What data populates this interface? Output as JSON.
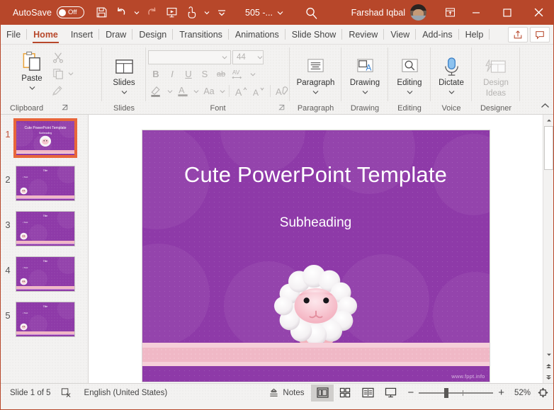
{
  "titlebar": {
    "autosave_label": "AutoSave",
    "autosave_state": "Off",
    "doc_name": "505 -...",
    "user_name": "Farshad Iqbal",
    "qat": [
      {
        "name": "save-icon",
        "label": "Save"
      },
      {
        "name": "undo-icon",
        "label": "Undo"
      },
      {
        "name": "redo-icon",
        "label": "Redo"
      },
      {
        "name": "start-presentation-icon",
        "label": "Start From Beginning"
      },
      {
        "name": "touch-mode-icon",
        "label": "Touch/Mouse Mode"
      },
      {
        "name": "customize-qat-icon",
        "label": "Customize Quick Access Toolbar"
      }
    ],
    "search_icon": "search-icon",
    "ribbon_display_icon": "ribbon-display-options-icon",
    "minimize": "–",
    "maximize": "□",
    "close": "✕"
  },
  "tabs": [
    {
      "label": "File",
      "active": false
    },
    {
      "label": "Home",
      "active": true
    },
    {
      "label": "Insert",
      "active": false
    },
    {
      "label": "Draw",
      "active": false
    },
    {
      "label": "Design",
      "active": false
    },
    {
      "label": "Transitions",
      "active": false
    },
    {
      "label": "Animations",
      "active": false
    },
    {
      "label": "Slide Show",
      "active": false
    },
    {
      "label": "Review",
      "active": false
    },
    {
      "label": "View",
      "active": false
    },
    {
      "label": "Add-ins",
      "active": false
    },
    {
      "label": "Help",
      "active": false
    }
  ],
  "tabbar_right": [
    {
      "name": "share-button",
      "label": "Share"
    },
    {
      "name": "comments-button",
      "label": "Comments"
    }
  ],
  "ribbon": {
    "groups": [
      {
        "label": "Clipboard"
      },
      {
        "label": "Slides"
      },
      {
        "label": "Font"
      },
      {
        "label": "Paragraph"
      },
      {
        "label": "Drawing"
      },
      {
        "label": "Editing"
      },
      {
        "label": "Voice"
      },
      {
        "label": "Designer"
      }
    ],
    "paste_label": "Paste",
    "cut_label": "Cut",
    "copy_label": "Copy",
    "format_painter_label": "Format Painter",
    "slides_label": "Slides",
    "paragraph_label": "Paragraph",
    "drawing_label": "Drawing",
    "editing_label": "Editing",
    "dictate_label": "Dictate",
    "design_ideas_label_1": "Design",
    "design_ideas_label_2": "Ideas",
    "font_name": "",
    "font_size": "44",
    "font_buttons": {
      "bold": "B",
      "italic": "I",
      "underline": "U",
      "shadow": "S",
      "strikethrough": "ab",
      "char_spacing": "AV",
      "text_highlight": "text-highlight-icon",
      "font_color": "A",
      "change_case": "Aa",
      "increase_size": "A",
      "decrease_size": "A",
      "clear_formatting": "clear-formatting-icon"
    }
  },
  "thumbnails": [
    {
      "number": "1",
      "selected": true
    },
    {
      "number": "2",
      "selected": false
    },
    {
      "number": "3",
      "selected": false
    },
    {
      "number": "4",
      "selected": false
    },
    {
      "number": "5",
      "selected": false
    }
  ],
  "slide": {
    "title": "Cute PowerPoint Template",
    "subheading": "Subheading",
    "watermark": "www.fppt.info",
    "bg_color": "#8e3aa8",
    "band_color": "#f0b8c6",
    "band_outer_color": "#f6cfd9"
  },
  "statusbar": {
    "slide_counter": "Slide 1 of 5",
    "accessibility_icon": "accessibility-checker-icon",
    "language": "English (United States)",
    "notes_label": "Notes",
    "views": [
      {
        "name": "view-normal",
        "active": true
      },
      {
        "name": "view-slide-sorter",
        "active": false
      },
      {
        "name": "view-reading",
        "active": false
      },
      {
        "name": "view-slide-show",
        "active": false
      }
    ],
    "zoom_out": "−",
    "zoom_in": "+",
    "zoom_level": "52%",
    "fit_icon": "fit-slide-to-window-icon"
  }
}
